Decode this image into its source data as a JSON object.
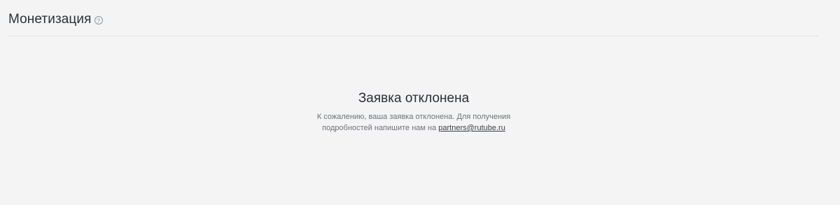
{
  "header": {
    "title": "Монетизация",
    "help_icon": "question-circle-icon",
    "help_glyph": "?"
  },
  "status": {
    "title": "Заявка отклонена",
    "line1": "К сожалению, ваша заявка отклонена. Для получения",
    "line2_prefix": "подробностей напишите нам на ",
    "email": "partners@rutube.ru"
  },
  "colors": {
    "background": "#f4f4f5",
    "text_primary": "#2b2f38",
    "text_secondary": "#6d717a"
  }
}
